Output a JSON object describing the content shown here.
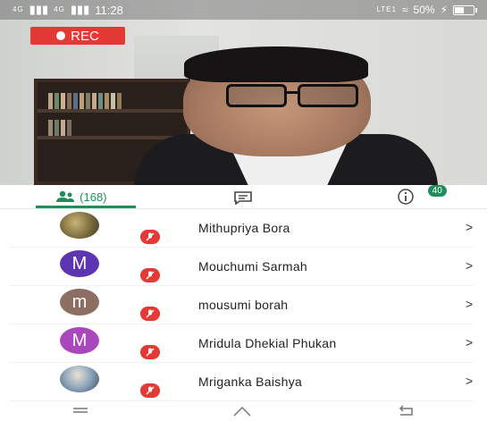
{
  "status_bar": {
    "signal_1": "4G",
    "signal_2": "4G",
    "time": "11:28",
    "network": "LTE1",
    "battery": "50%",
    "battery_level": 0.5
  },
  "video": {
    "rec_label": "REC"
  },
  "tabs": {
    "people_count": "(168)",
    "chat_badge": "40"
  },
  "participants": [
    {
      "name": "Mithupriya Bora",
      "avatar_letter": "",
      "avatar_color": "#7a6a3c",
      "photo": true
    },
    {
      "name": "Mouchumi Sarmah",
      "avatar_letter": "M",
      "avatar_color": "#5e35b1",
      "photo": false
    },
    {
      "name": "mousumi borah",
      "avatar_letter": "m",
      "avatar_color": "#8d6e63",
      "photo": false
    },
    {
      "name": "Mridula Dhekial Phukan",
      "avatar_letter": "M",
      "avatar_color": "#ab47bc",
      "photo": false
    },
    {
      "name": "Mriganka Baishya",
      "avatar_letter": "",
      "avatar_color": "#5d7fa3",
      "photo": true
    }
  ],
  "chevron": ">",
  "colors": {
    "accent": "#1e8e5a",
    "rec": "#e53935",
    "mute": "#e53935"
  }
}
